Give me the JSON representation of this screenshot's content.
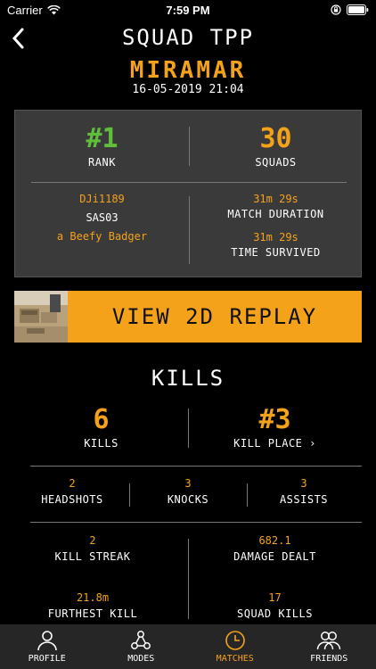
{
  "status_bar": {
    "carrier": "Carrier",
    "time": "7:59 PM"
  },
  "header": {
    "title": "SQUAD TPP"
  },
  "match": {
    "map": "MIRAMAR",
    "datetime": "16-05-2019 21:04"
  },
  "summary": {
    "rank_value": "#1",
    "rank_label": "RANK",
    "squads_value": "30",
    "squads_label": "SQUADS",
    "team": [
      "DJi1189",
      "SAS03",
      "a Beefy Badger"
    ],
    "match_duration_value": "31m 29s",
    "match_duration_label": "MATCH DURATION",
    "time_survived_value": "31m 29s",
    "time_survived_label": "TIME SURVIVED"
  },
  "replay": {
    "label": "VIEW 2D REPLAY"
  },
  "kills_section": {
    "title": "KILLS",
    "kills_value": "6",
    "kills_label": "KILLS",
    "kill_place_value": "#3",
    "kill_place_label": "KILL PLACE ›",
    "headshots_value": "2",
    "headshots_label": "HEADSHOTS",
    "knocks_value": "3",
    "knocks_label": "KNOCKS",
    "assists_value": "3",
    "assists_label": "ASSISTS",
    "kill_streak_value": "2",
    "kill_streak_label": "KILL STREAK",
    "damage_value": "682.1",
    "damage_label": "DAMAGE DEALT",
    "furthest_value": "21.8m",
    "furthest_label": "FURTHEST KILL",
    "squad_kills_value": "17",
    "squad_kills_label": "SQUAD KILLS"
  },
  "tabs": [
    {
      "label": "PROFILE",
      "icon": "person-icon"
    },
    {
      "label": "MODES",
      "icon": "network-icon"
    },
    {
      "label": "MATCHES",
      "icon": "clock-icon"
    },
    {
      "label": "FRIENDS",
      "icon": "friends-icon"
    }
  ],
  "colors": {
    "accent": "#f5a21b",
    "rank_green": "#5fbf3a",
    "panel": "#3a3a3a",
    "tabbar": "#262626"
  }
}
